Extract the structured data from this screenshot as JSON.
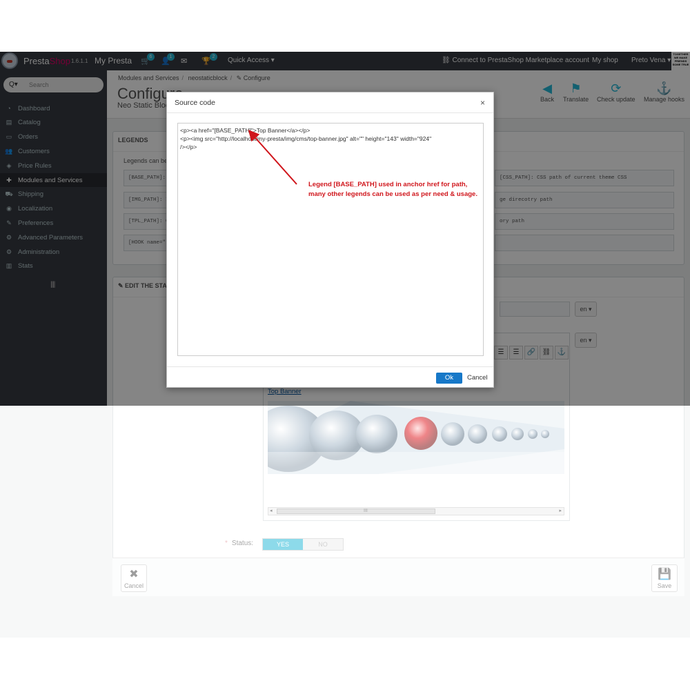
{
  "topbar": {
    "brand_main": "Presta",
    "brand_shop": "Shop",
    "version": "1.6.1.1",
    "shop_name": "My Presta",
    "badges": {
      "orders": "6",
      "customers": "1",
      "messages": "",
      "trophy": "2"
    },
    "quick_access": "Quick Access ▾",
    "connect": "Connect to PrestaShop Marketplace account",
    "my_shop": "My shop",
    "user": "Preto Vena ▾",
    "stamp": "TOGETHER WE MAKE FRIENDS SOME TRUE"
  },
  "sidebar": {
    "search_icon": "Q▾",
    "search_placeholder": "Search",
    "items": [
      {
        "label": "Dashboard",
        "icon": "dashboard-icon",
        "glyph": "◔"
      },
      {
        "label": "Catalog",
        "icon": "catalog-icon",
        "glyph": "▤"
      },
      {
        "label": "Orders",
        "icon": "orders-icon",
        "glyph": "▭"
      },
      {
        "label": "Customers",
        "icon": "customers-icon",
        "glyph": "👥"
      },
      {
        "label": "Price Rules",
        "icon": "price-rules-icon",
        "glyph": "◈"
      },
      {
        "label": "Modules and Services",
        "icon": "modules-icon",
        "glyph": "✚"
      },
      {
        "label": "Shipping",
        "icon": "shipping-icon",
        "glyph": "⛟"
      },
      {
        "label": "Localization",
        "icon": "localization-icon",
        "glyph": "◉"
      },
      {
        "label": "Preferences",
        "icon": "preferences-icon",
        "glyph": "✎"
      },
      {
        "label": "Advanced Parameters",
        "icon": "advanced-icon",
        "glyph": "⚙"
      },
      {
        "label": "Administration",
        "icon": "administration-icon",
        "glyph": "⚙"
      },
      {
        "label": "Stats",
        "icon": "stats-icon",
        "glyph": "▥"
      }
    ],
    "active_index": 5,
    "collapse": "||||"
  },
  "header": {
    "breadcrumb": [
      "Modules and Services",
      "neostaticblock",
      "✎ Configure"
    ],
    "title": "Configure",
    "subtitle": "Neo Static Block",
    "tools": [
      {
        "label": "Back",
        "icon": "back-icon",
        "glyph": "◀"
      },
      {
        "label": "Translate",
        "icon": "flag-icon",
        "glyph": "⚑"
      },
      {
        "label": "Check update",
        "icon": "refresh-icon",
        "glyph": "⟳"
      },
      {
        "label": "Manage hooks",
        "icon": "anchor-icon",
        "glyph": "⚓"
      }
    ]
  },
  "legends_panel": {
    "title": "LEGENDS",
    "intro": "Legends can be",
    "rows_left": [
      "[BASE_PATH]:",
      "[IMG_PATH]: I",
      "[TPL_PATH]: C",
      "[HOOK name=\""
    ],
    "rows_right": [
      "[CSS_PATH]: CSS path of current theme CSS",
      "ge direcotry path",
      "ory path",
      ""
    ]
  },
  "edit_panel": {
    "title": "EDIT THE STATI",
    "lang": "en ▾"
  },
  "editor": {
    "toolbar_buttons": [
      "☰",
      "☰",
      "🔗",
      "⛓",
      "⚓"
    ],
    "link_text": "Top Banner",
    "scroll_mid": "III"
  },
  "status": {
    "label": "Status:",
    "yes": "YES",
    "no": "NO"
  },
  "footer": {
    "cancel": "Cancel",
    "save": "Save"
  },
  "modal": {
    "title": "Source code",
    "close": "×",
    "code_lines": [
      "<p><a href=\"[BASE_PATH]\">Top Banner</a></p>",
      "<p><img src=\"http://localhost/my-presta/img/cms/top-banner.jpg\" alt=\"\" height=\"143\" width=\"924\"",
      "/></p>"
    ],
    "annotation_line1": "Legend [BASE_PATH] used in anchor href for path,",
    "annotation_line2": "many other legends can be used as per need & usage.",
    "ok": "Ok",
    "cancel": "Cancel"
  },
  "colors": {
    "accent": "#25b9d7",
    "sidebar_bg": "#363a41",
    "annotation": "#d0161c",
    "ok_button": "#1778c8"
  }
}
